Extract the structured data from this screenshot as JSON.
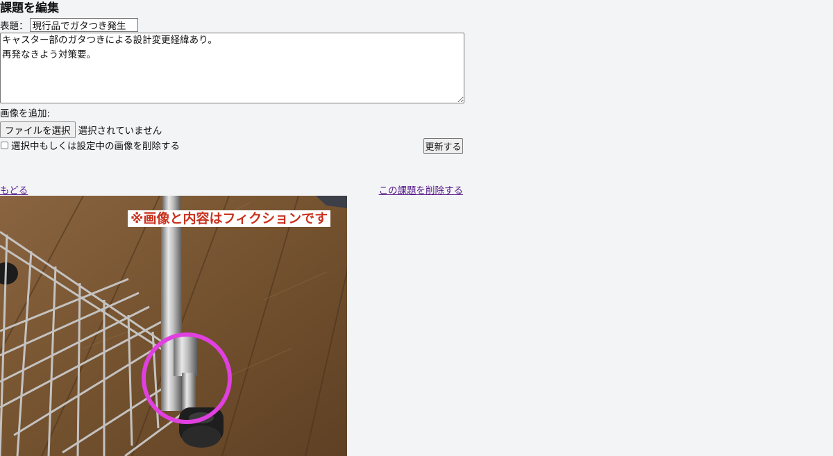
{
  "page": {
    "title": "課題を編集"
  },
  "form": {
    "subject_label": "表題：",
    "subject_value": "現行品でガタつき発生",
    "body_value": "キャスター部のガタつきによる設計変更経緯あり。\n再発なきよう対策要。",
    "add_image_label": "画像を追加:",
    "file_button_label": "ファイルを選択",
    "file_status": "選択されていません",
    "delete_images_label": "選択中もしくは設定中の画像を削除する",
    "delete_images_checked": false,
    "update_button_label": "更新する"
  },
  "links": {
    "back": "もどる",
    "delete_issue": "この課題を削除する"
  },
  "image": {
    "caption": "※画像と内容はフィクションです",
    "caption_color": "#c8321e",
    "highlight_color": "#e040e0"
  }
}
